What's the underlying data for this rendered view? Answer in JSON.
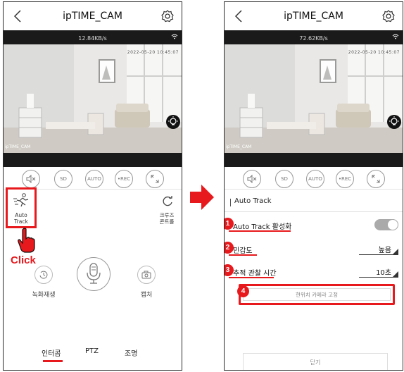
{
  "left_phone": {
    "title": "ipTIME_CAM",
    "kbps": "12.84KB/s",
    "timestamp": "2022-05-20 10:45:07",
    "cam_label": "ipTIME_CAM",
    "controls": [
      "SD",
      "AUTO",
      "•REC"
    ],
    "auto_track": {
      "label_line1": "Auto",
      "label_line2": "Track"
    },
    "cruise": {
      "label_line1": "크루즈",
      "label_line2": "콘트롤"
    },
    "click_label": "Click",
    "record_label": "녹화재생",
    "capture_label": "캡처",
    "tabs": [
      "인터콤",
      "PTZ",
      "조명"
    ]
  },
  "right_phone": {
    "title": "ipTIME_CAM",
    "kbps": "72.62KB/s",
    "timestamp": "2022-05-20 10:45:07",
    "cam_label": "ipTIME_CAM",
    "controls": [
      "SD",
      "AUTO",
      "•REC"
    ],
    "panel_title": "Auto Track",
    "settings": [
      {
        "badge": "1",
        "label": "Auto Track 활성화",
        "type": "toggle",
        "value": "on"
      },
      {
        "badge": "2",
        "label": "민감도",
        "type": "select",
        "value": "높음"
      },
      {
        "badge": "3",
        "label": "추적 관찰 시간",
        "type": "select",
        "value": "10초"
      }
    ],
    "fix_button": {
      "badge": "4",
      "label": "현위치 카메라 고정"
    },
    "close_label": "닫기"
  },
  "colors": {
    "accent": "#e8191d",
    "toggle_on": "#aaaaaa"
  }
}
